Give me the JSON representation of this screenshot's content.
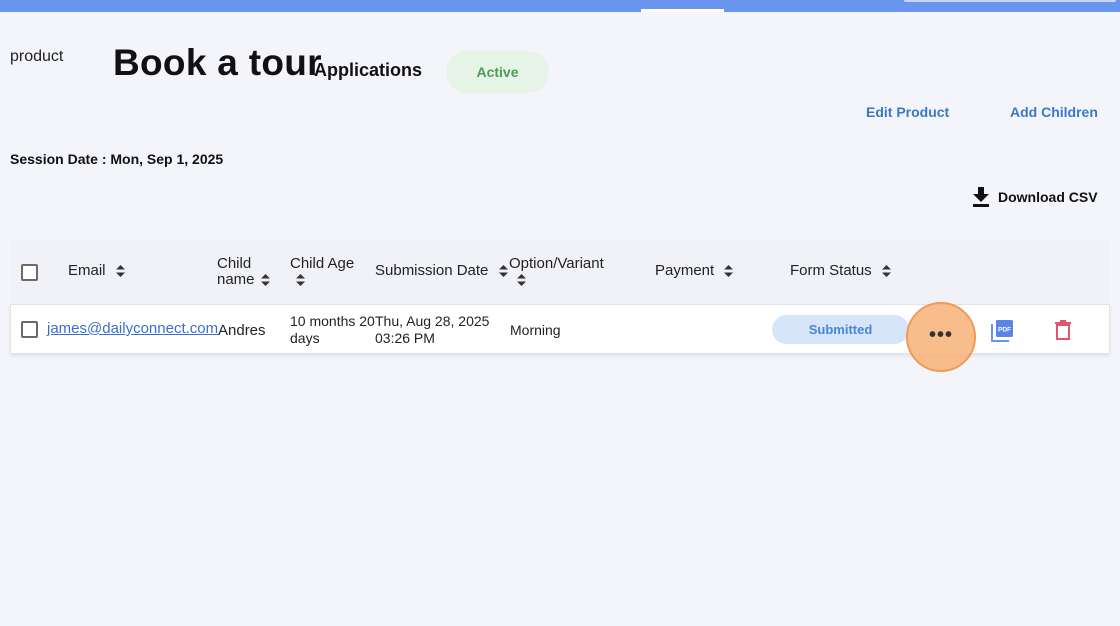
{
  "header": {
    "product_image_alt": "product",
    "title": "Book a tour",
    "subtitle": "Applications",
    "status": "Active",
    "edit_product": "Edit Product",
    "add_children": "Add Children"
  },
  "session": {
    "label": "Session Date : Mon, Sep 1, 2025"
  },
  "actions": {
    "download_csv": "Download CSV"
  },
  "table": {
    "columns": {
      "email": "Email",
      "child_name_1": "Child",
      "child_name_2": "name",
      "child_age": "Child Age",
      "submission_date": "Submission Date",
      "option_variant": "Option/Variant",
      "payment": "Payment",
      "form_status": "Form Status"
    },
    "rows": [
      {
        "email": "james@dailyconnect.com",
        "child_name": "Andres",
        "child_age_1": "10 months 20",
        "child_age_2": "days",
        "submission_1": "Thu, Aug 28, 2025",
        "submission_2": "03:26 PM",
        "option": "Morning",
        "payment": "",
        "form_status": "Submitted",
        "more": "•••"
      }
    ]
  },
  "colors": {
    "accent": "#3b78c9",
    "topbar": "#6a95ee",
    "active_bg": "#e5f4e6",
    "active_fg": "#4f9a57",
    "submitted_bg": "#d7e5fb",
    "submitted_fg": "#4a85d6",
    "delete": "#e0566a",
    "highlight": "#f8b278"
  },
  "icons": [
    "download-icon",
    "sort-icon",
    "more-icon",
    "pdf-icon",
    "trash-icon"
  ]
}
